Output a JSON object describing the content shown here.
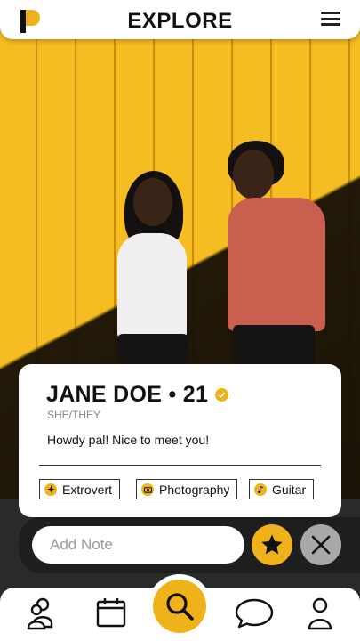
{
  "header": {
    "title": "EXPLORE"
  },
  "profile": {
    "name_age": "JANE DOE • 21",
    "pronouns": "SHE/THEY",
    "bio": "Howdy pal! Nice to meet you!",
    "interests": [
      {
        "label": "Extrovert",
        "icon": "sparkle-icon"
      },
      {
        "label": "Photography",
        "icon": "camera-icon"
      },
      {
        "label": "Guitar",
        "icon": "music-note-icon"
      }
    ]
  },
  "note": {
    "placeholder": "Add Note"
  },
  "nav": {
    "items": [
      "matches-icon",
      "calendar-icon",
      "search-icon",
      "chat-icon",
      "profile-icon"
    ]
  },
  "colors": {
    "accent": "#f0b21a",
    "dark": "#1e1e1e",
    "pass_button": "#a8a8a8"
  }
}
